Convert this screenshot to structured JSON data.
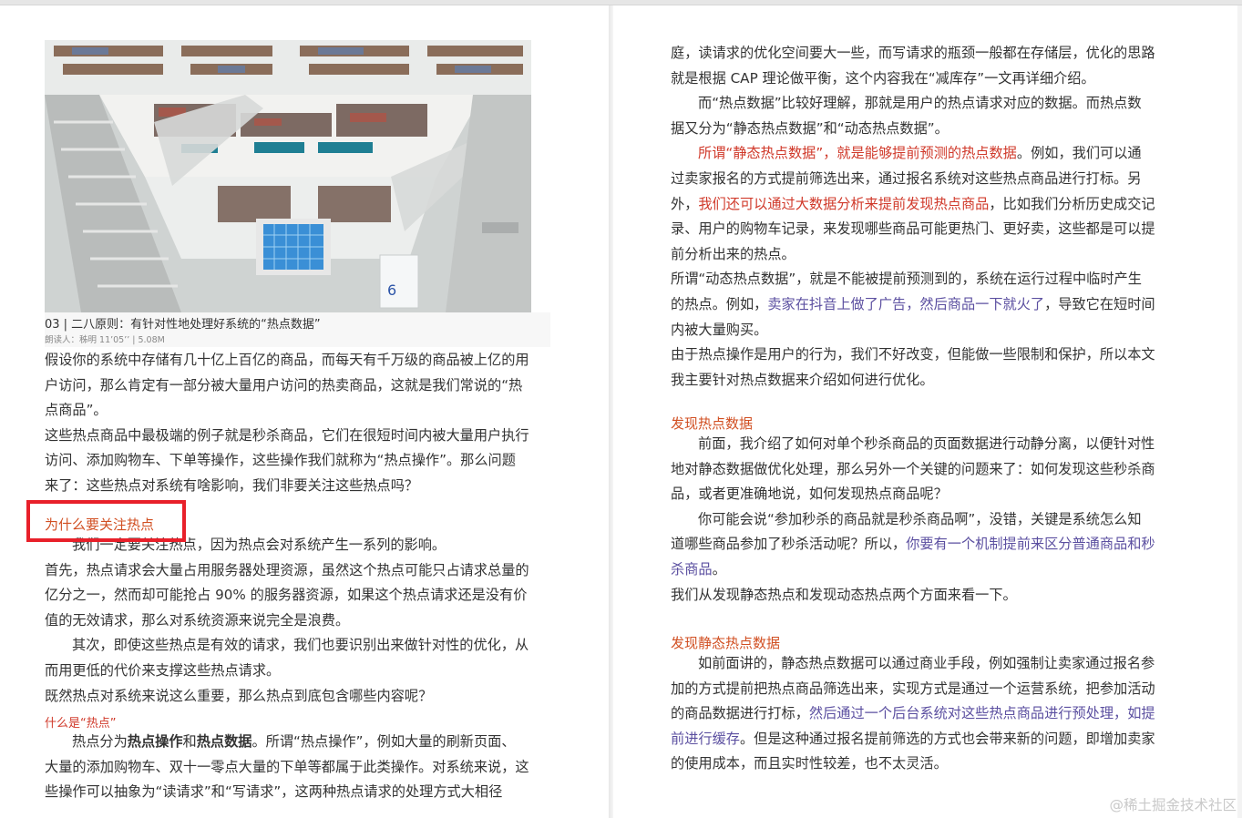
{
  "left": {
    "caption_title": "03 | 二八原则：有针对性地处理好系统的“热点数据”",
    "caption_meta": "朗读人：秭明    11’05’’ | 5.08M",
    "p1": [
      "假设你的系统中存储有几十亿上百亿的商品，而每天有千万级的商品被上亿的用",
      "户访问，那么肯定有一部分被大量用户访问的热卖商品，这就是我们常说的“热",
      "点商品”。"
    ],
    "p2": [
      "这些热点商品中最极端的例子就是秒杀商品，它们在很短时间内被大量用户执行",
      "访问、添加购物车、下单等操作，这些操作我们就称为“热点操作”。那么问题",
      "来了：这些热点对系统有啥影响，我们非要关注这些热点吗？"
    ],
    "h1": "为什么要关注热点",
    "p3": "我们一定要关注热点，因为热点会对系统产生一系列的影响。",
    "p4": [
      "首先，热点请求会大量占用服务器处理资源，虽然这个热点可能只占请求总量的",
      "亿分之一，然而却可能抢占 90% 的服务器资源，如果这个热点请求还是没有价",
      "值的无效请求，那么对系统资源来说完全是浪费。"
    ],
    "p5": [
      "其次，即使这些热点是有效的请求，我们也要识别出来做针对性的优化，从",
      "而用更低的代价来支撑这些热点请求。"
    ],
    "p6": "既然热点对系统来说这么重要，那么热点到底包含哪些内容呢？",
    "h2": "什么是“热点”",
    "p7": {
      "a": "热点分为",
      "b": "热点操作",
      "c": "和",
      "d": "热点数据",
      "e": "。所谓“热点操作”，例如大量的刷新页面、",
      "l2": "大量的添加购物车、双十一零点大量的下单等都属于此类操作。对系统来说，这",
      "l3": "些操作可以抽象为“读请求”和“写请求”，这两种热点请求的处理方式大相径"
    }
  },
  "right": {
    "r1": [
      "庭，读请求的优化空间要大一些，而写请求的瓶颈一般都在存储层，优化的思路",
      "就是根据 CAP 理论做平衡，这个内容我在“减库存”一文再详细介绍。"
    ],
    "r2": [
      "而“热点数据”比较好理解，那就是用户的热点请求对应的数据。而热点数",
      "据又分为“静态热点数据”和“动态热点数据”。"
    ],
    "r3": {
      "red": "所谓“静态热点数据”，就是能够提前预测的热点数据",
      "tail": "。例如，我们可以通",
      "l2": "过卖家报名的方式提前筛选出来，通过报名系统对这些热点商品进行打标。另",
      "l3a": "外，",
      "l3red": "我们还可以通过大数据分析来提前发现热点商品",
      "l3b": "，比如我们分析历史成交记",
      "l4": "录、用户的购物车记录，来发现哪些商品可能更热门、更好卖，这些都是可以提",
      "l5": "前分析出来的热点。"
    },
    "r4": {
      "l1": "所谓“动态热点数据”，就是不能被提前预测到的，系统在运行过程中临时产生",
      "l2a": "的热点。例如，",
      "l2p": "卖家在抖音上做了广告，然后商品一下就火了",
      "l2b": "，导致它在短时间",
      "l3": "内被大量购买。"
    },
    "r5": [
      "由于热点操作是用户的行为，我们不好改变，但能做一些限制和保护，所以本文",
      "我主要针对热点数据来介绍如何进行优化。"
    ],
    "h3": "发现热点数据",
    "r6": [
      "前面，我介绍了如何对单个秒杀商品的页面数据进行动静分离，以便针对性",
      "地对静态数据做优化处理，那么另外一个关键的问题来了：如何发现这些秒杀商",
      "品，或者更准确地说，如何发现热点商品呢？"
    ],
    "r7": {
      "l1": "你可能会说“参加秒杀的商品就是秒杀商品啊”，没错，关键是系统怎么知",
      "l2a": "道哪些商品参加了秒杀活动呢？所以，",
      "l2p": "你要有一个机制提前来区分普通商品和秒",
      "l3p": "杀商品",
      "l3b": "。"
    },
    "r8": "我们从发现静态热点和发现动态热点两个方面来看一下。",
    "h4": "发现静态热点数据",
    "r9": {
      "l1": "如前面讲的，静态热点数据可以通过商业手段，例如强制让卖家通过报名参",
      "l2": "加的方式提前把热点商品筛选出来，实现方式是通过一个运营系统，把参加活动",
      "l3a": "的商品数据进行打标，",
      "l3p": "然后通过一个后台系统对这些热点商品进行预处理，如提",
      "l4p": "前进行缓存",
      "l4b": "。但是这种通过报名提前筛选的方式也会带来新的问题，即增加卖家",
      "l5": "的使用成本，而且实时性较差，也不太灵活。"
    }
  },
  "watermark": "@稀土掘金技术社区",
  "colors": {
    "red_text": "#d0392a",
    "purple_text": "#5b4fa0",
    "heading": "#d14f22",
    "highlight_box": "#e8202a"
  },
  "image": {
    "icon": "library-photo"
  }
}
